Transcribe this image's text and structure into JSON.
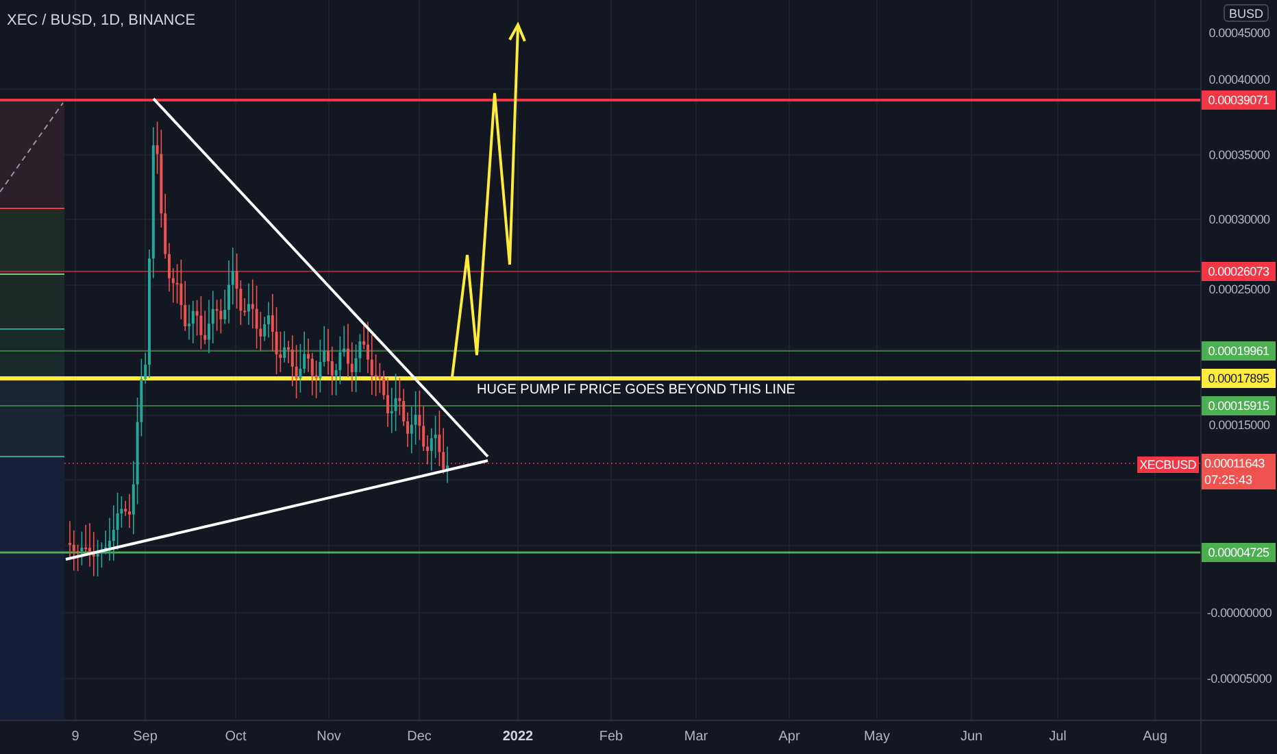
{
  "title": "XEC / BUSD, 1D, BINANCE",
  "currency_badge": "BUSD",
  "price_axis": [
    {
      "label": "0.00045000"
    },
    {
      "label": "0.00040000"
    },
    {
      "label": "0.00035000"
    },
    {
      "label": "0.00030000"
    },
    {
      "label": "0.00025000"
    },
    {
      "label": "0.00015000"
    },
    {
      "label": "-0.00000000"
    },
    {
      "label": "-0.00005000"
    }
  ],
  "price_levels": [
    {
      "label": "0.00039071",
      "color": "#f23645"
    },
    {
      "label": "0.00026073",
      "color": "#f23645"
    },
    {
      "label": "0.00019961",
      "color": "#4caf50"
    },
    {
      "label": "0.00017895",
      "color": "#ffeb3b"
    },
    {
      "label": "0.00015915",
      "color": "#4caf50"
    },
    {
      "label": "0.00004725",
      "color": "#4caf50"
    }
  ],
  "last_price": {
    "symbol": "XECBUSD",
    "price": "0.00011643",
    "countdown": "07:25:43"
  },
  "annotation": "HUGE PUMP IF PRICE GOES BEYOND THIS LINE",
  "time_axis": [
    {
      "label": "9",
      "emphasis": false
    },
    {
      "label": "Sep",
      "emphasis": false
    },
    {
      "label": "Oct",
      "emphasis": false
    },
    {
      "label": "Nov",
      "emphasis": false
    },
    {
      "label": "Dec",
      "emphasis": false
    },
    {
      "label": "2022",
      "emphasis": true
    },
    {
      "label": "Feb",
      "emphasis": false
    },
    {
      "label": "Mar",
      "emphasis": false
    },
    {
      "label": "Apr",
      "emphasis": false
    },
    {
      "label": "May",
      "emphasis": false
    },
    {
      "label": "Jun",
      "emphasis": false
    },
    {
      "label": "Jul",
      "emphasis": false
    },
    {
      "label": "Aug",
      "emphasis": false
    }
  ]
}
